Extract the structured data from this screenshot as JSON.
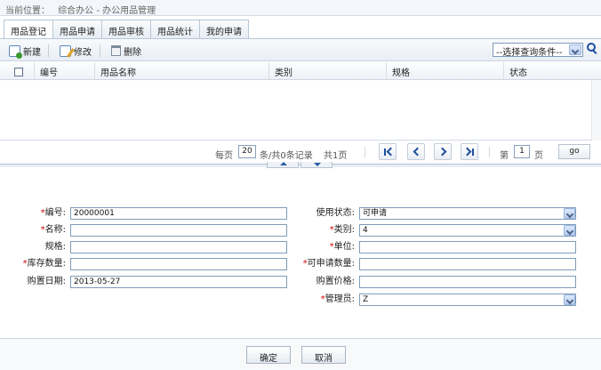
{
  "breadcrumb": {
    "label": "当前位置：",
    "path": "综合办公 - 办公用品管理"
  },
  "tabs": [
    "用品登记",
    "用品申请",
    "用品审核",
    "用品统计",
    "我的申请"
  ],
  "toolbar": {
    "new_label": "新建",
    "edit_label": "修改",
    "delete_label": "删除",
    "query_placeholder": "--选择查询条件--"
  },
  "grid": {
    "columns": [
      "编号",
      "用品名称",
      "类别",
      "规格",
      "状态"
    ]
  },
  "pager": {
    "per_page_label": "每页",
    "per_page": "20",
    "record_text": "条/共0条记录",
    "pages_text": "共1页",
    "page_prefix": "第",
    "page": "1",
    "page_suffix": "页",
    "go_label": "go"
  },
  "form": {
    "code": {
      "label": "编号:",
      "value": "20000001"
    },
    "name": {
      "label": "名称:",
      "value": ""
    },
    "spec": {
      "label": "规格:",
      "value": ""
    },
    "stock": {
      "label": "库存数量:",
      "value": ""
    },
    "purchase_date": {
      "label": "购置日期:",
      "value": "2013-05-27"
    },
    "use_status": {
      "label": "使用状态:",
      "value": "可申请"
    },
    "category": {
      "label": "类别:",
      "value": "4"
    },
    "unit": {
      "label": "单位:",
      "value": ""
    },
    "apply_qty": {
      "label": "可申请数量:",
      "value": ""
    },
    "purchase_price": {
      "label": "购置价格:",
      "value": ""
    },
    "admin": {
      "label": "管理员:",
      "value": "Z"
    }
  },
  "footer": {
    "confirm_label": "确定",
    "cancel_label": "取消"
  }
}
